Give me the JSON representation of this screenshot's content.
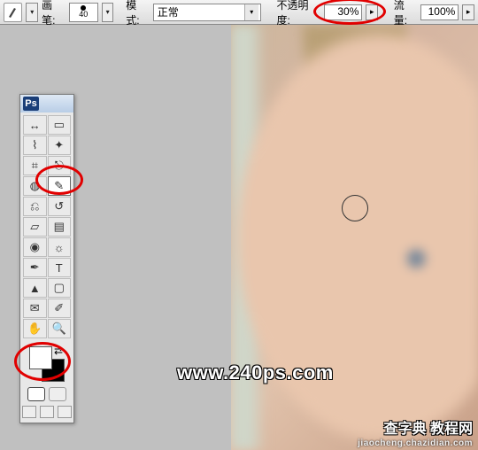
{
  "options_bar": {
    "brush_label": "画笔:",
    "brush_size": "40",
    "mode_label": "模式:",
    "mode_value": "正常",
    "opacity_label": "不透明度:",
    "opacity_value": "30%",
    "flow_label": "流量:",
    "flow_value": "100%"
  },
  "tools": {
    "panel_logo": "Ps",
    "cells": [
      {
        "name": "move-tool",
        "icon": "↔"
      },
      {
        "name": "marquee-tool",
        "icon": "▭"
      },
      {
        "name": "lasso-tool",
        "icon": "⌇"
      },
      {
        "name": "magic-wand-tool",
        "icon": "✦"
      },
      {
        "name": "crop-tool",
        "icon": "⌗"
      },
      {
        "name": "slice-tool",
        "icon": "⎋"
      },
      {
        "name": "healing-brush-tool",
        "icon": "◍"
      },
      {
        "name": "brush-tool",
        "icon": "✎",
        "active": true
      },
      {
        "name": "clone-stamp-tool",
        "icon": "⎌"
      },
      {
        "name": "history-brush-tool",
        "icon": "↺"
      },
      {
        "name": "eraser-tool",
        "icon": "▱"
      },
      {
        "name": "gradient-tool",
        "icon": "▤"
      },
      {
        "name": "blur-tool",
        "icon": "◉"
      },
      {
        "name": "dodge-tool",
        "icon": "☼"
      },
      {
        "name": "pen-tool",
        "icon": "✒"
      },
      {
        "name": "type-tool",
        "icon": "T"
      },
      {
        "name": "path-selection-tool",
        "icon": "▲"
      },
      {
        "name": "shape-tool",
        "icon": "▢"
      },
      {
        "name": "notes-tool",
        "icon": "✉"
      },
      {
        "name": "eyedropper-tool",
        "icon": "✐"
      },
      {
        "name": "hand-tool",
        "icon": "✋"
      },
      {
        "name": "zoom-tool",
        "icon": "🔍"
      }
    ],
    "foreground_color": "#ffffff",
    "background_color": "#000000"
  },
  "highlights": [
    {
      "name": "opacity-highlight",
      "style": "left:354px;top:-2px;width:82px;height:30px"
    },
    {
      "name": "brush-tool-highlight",
      "style": "left:40px;top:186px;width:54px;height:34px"
    },
    {
      "name": "swatches-highlight",
      "style": "left:16px;top:386px;width:64px;height:44px"
    }
  ],
  "watermarks": {
    "center": "www.240ps.com",
    "right1": "查字典 教程网",
    "right2": "jiaocheng.chazidian.com"
  }
}
